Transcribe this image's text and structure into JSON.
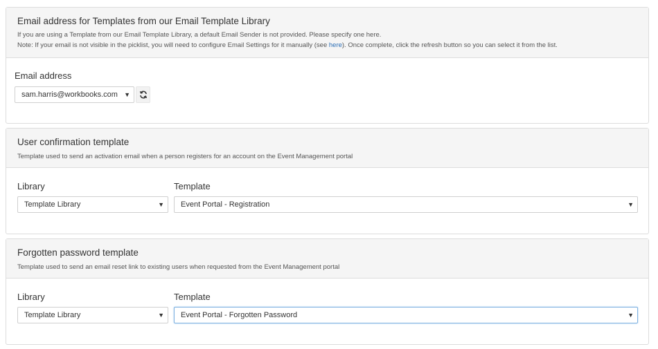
{
  "sender": {
    "title": "Email address for Templates from our Email Template Library",
    "desc_line1": "If you are using a Template from our Email Template Library, a default Email Sender is not provided. Please specify one here.",
    "desc_line2_pre": "Note: If your email is not visible in the picklist, you will need to configure Email Settings for it manually (see ",
    "desc_link": "here",
    "desc_line2_post": "). Once complete, click the refresh button so you can select it from the list.",
    "field_label": "Email address",
    "email_value": "sam.harris@workbooks.com",
    "refresh_icon": "refresh-icon"
  },
  "confirmation": {
    "title": "User confirmation template",
    "desc": "Template used to send an activation email when a person registers for an account on the Event Management portal",
    "library_label": "Library",
    "library_value": "Template Library",
    "template_label": "Template",
    "template_value": "Event Portal - Registration"
  },
  "forgotten": {
    "title": "Forgotten password template",
    "desc": "Template used to send an email reset link to existing users when requested from the Event Management portal",
    "library_label": "Library",
    "library_value": "Template Library",
    "template_label": "Template",
    "template_value": "Event Portal - Forgotten Password"
  },
  "colors": {
    "link": "#2a6db5",
    "focus_border": "#7fb2e0",
    "panel_header_bg": "#f5f5f5"
  }
}
